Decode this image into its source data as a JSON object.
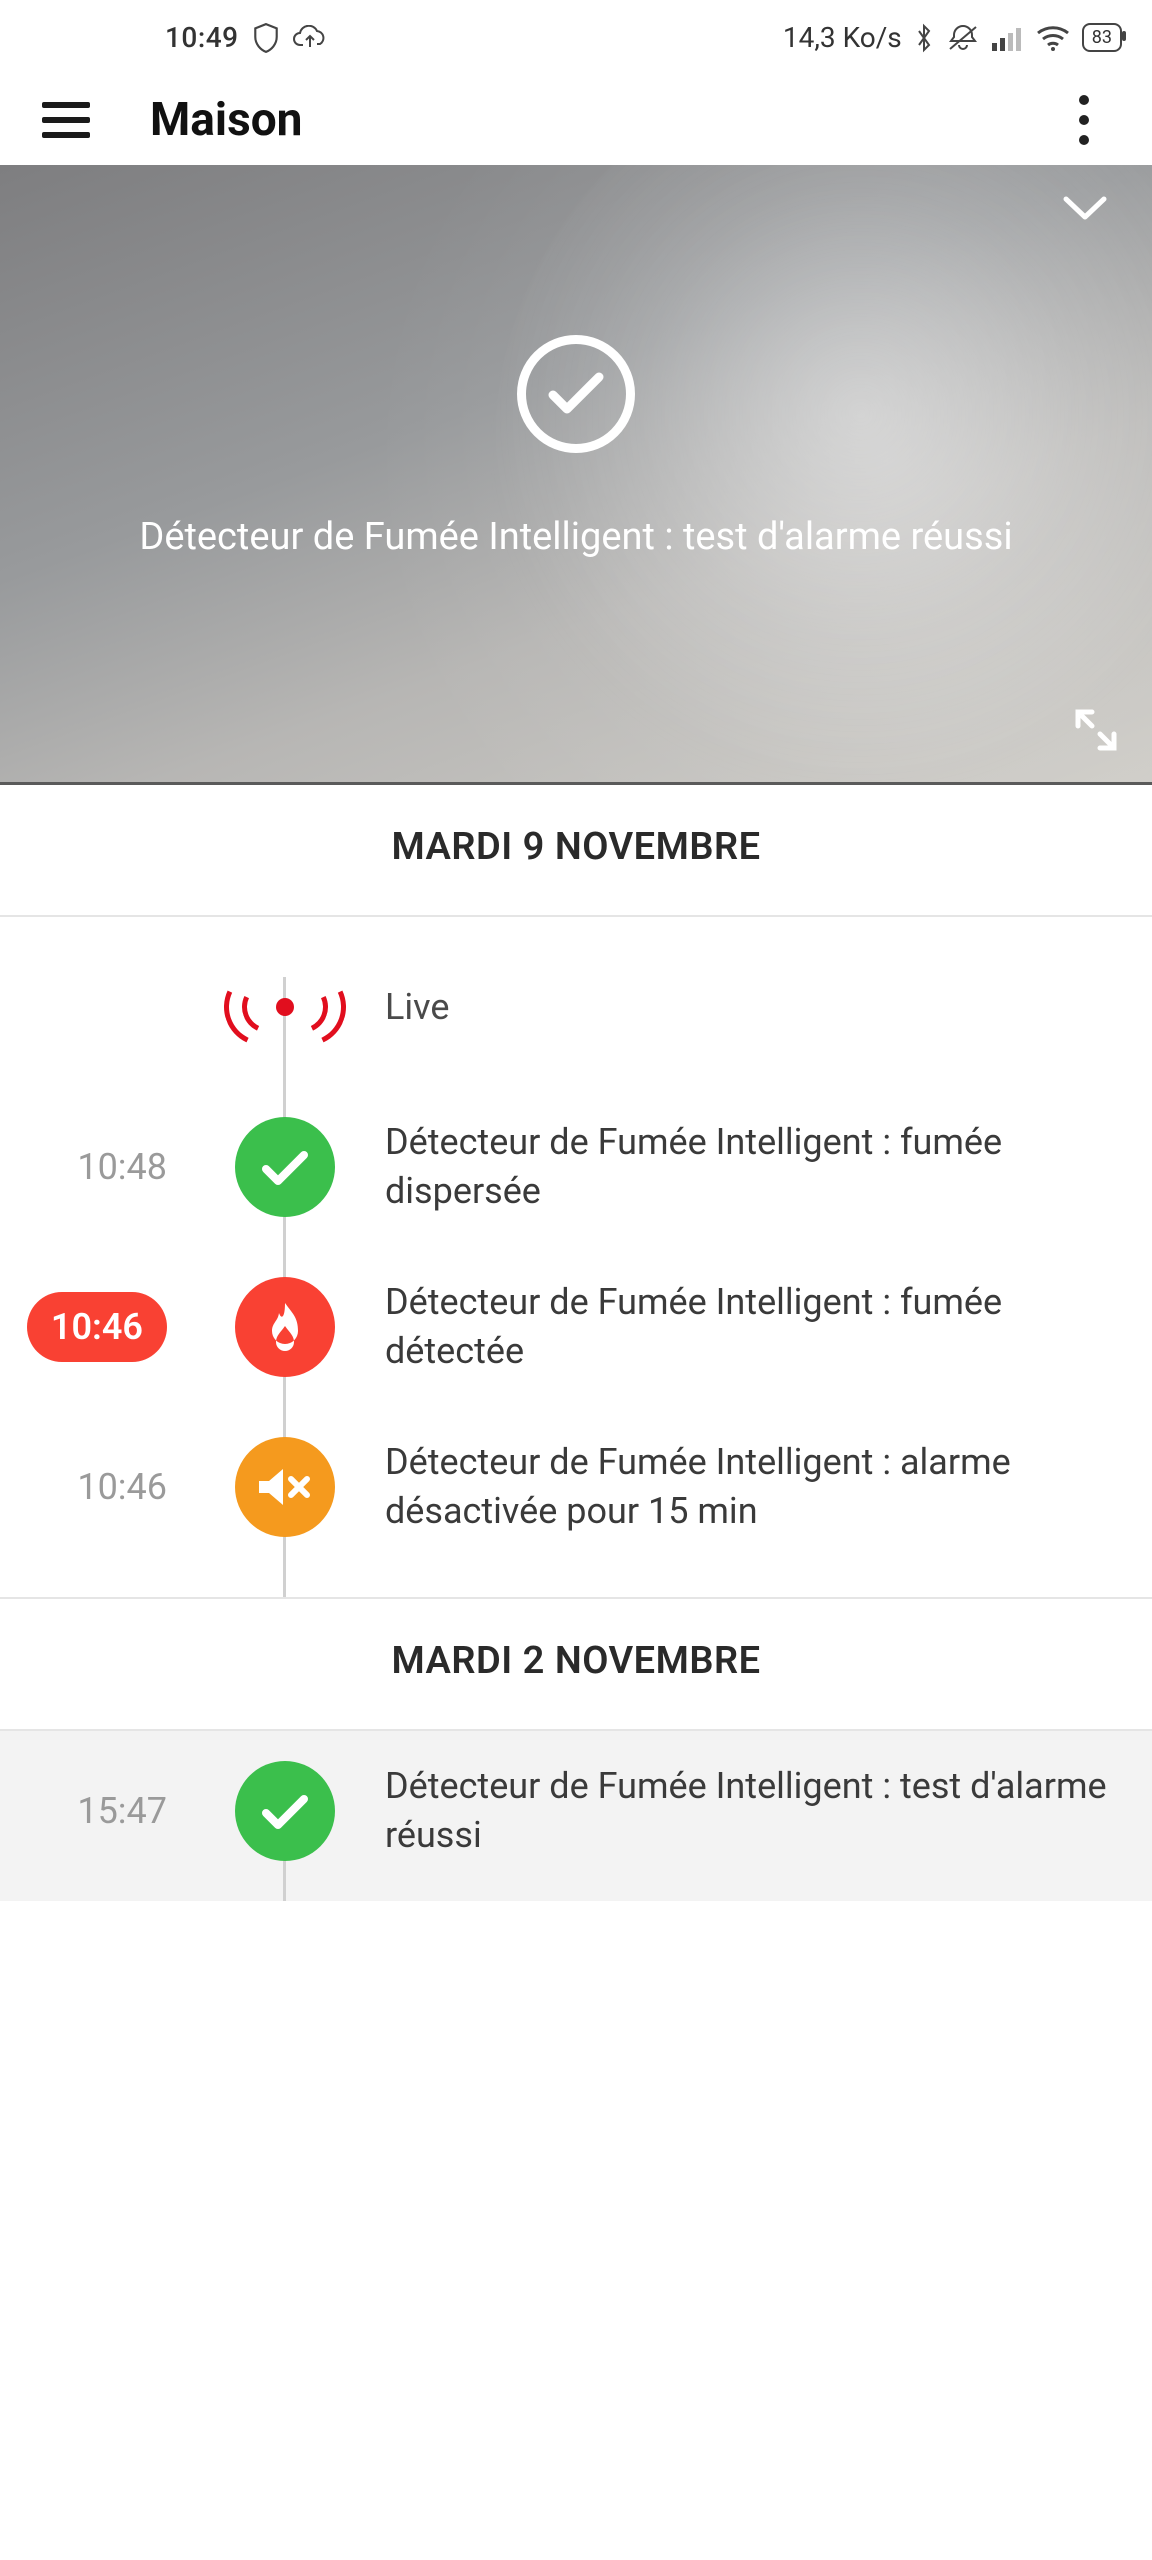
{
  "status_bar": {
    "time": "10:49",
    "net_speed": "14,3 Ko/s",
    "battery": "83"
  },
  "app_bar": {
    "title": "Maison"
  },
  "hero": {
    "message": "Détecteur de Fumée Intelligent : test d'alarme réussi"
  },
  "sections": [
    {
      "date": "MARDI 9 NOVEMBRE",
      "events": [
        {
          "type": "live",
          "time": "",
          "label": "Live"
        },
        {
          "type": "ok",
          "time": "10:48",
          "label": "Détecteur de Fumée Intelligent : fumée dispersée"
        },
        {
          "type": "fire",
          "time": "10:46",
          "label": "Détecteur de Fumée Intelligent : fumée détectée",
          "highlight": true
        },
        {
          "type": "mute",
          "time": "10:46",
          "label": "Détecteur de Fumée Intelligent : alarme désactivée pour 15 min"
        }
      ]
    },
    {
      "date": "MARDI 2 NOVEMBRE",
      "events": [
        {
          "type": "ok",
          "time": "15:47",
          "label": "Détecteur de Fumée Intelligent : test d'alarme réussi"
        }
      ]
    }
  ]
}
